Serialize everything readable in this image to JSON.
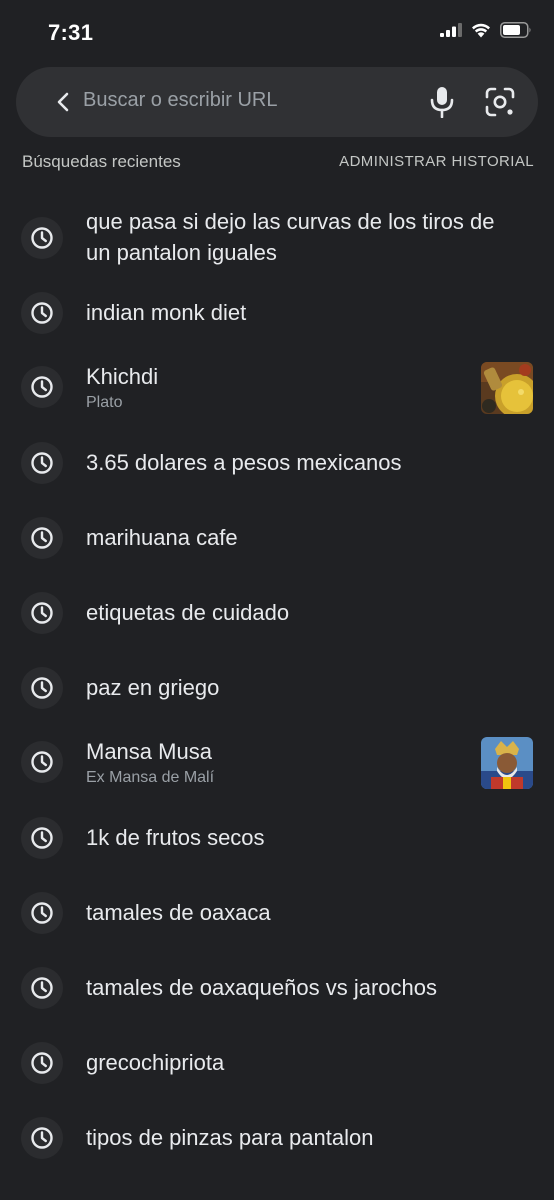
{
  "status_bar": {
    "time": "7:31"
  },
  "search": {
    "placeholder": "Buscar o escribir URL"
  },
  "recent": {
    "title": "Búsquedas recientes",
    "manage_label": "ADMINISTRAR HISTORIAL",
    "items": [
      {
        "line1": "que pasa si dejo las curvas de los tiros de",
        "line2": "un pantalon iguales"
      },
      {
        "title": "indian monk diet"
      },
      {
        "title": "Khichdi",
        "subtitle": "Plato"
      },
      {
        "title": "3.65 dolares a pesos mexicanos"
      },
      {
        "title": "marihuana cafe"
      },
      {
        "title": "etiquetas de cuidado"
      },
      {
        "title": "paz en griego"
      },
      {
        "title": "Mansa Musa",
        "subtitle": "Ex Mansa de Malí"
      },
      {
        "title": "1k de frutos secos"
      },
      {
        "title": "tamales de oaxaca"
      },
      {
        "title": "tamales de oaxaqueños vs jarochos"
      },
      {
        "title": "grecochipriota"
      },
      {
        "title": "tipos de pinzas para pantalon"
      }
    ]
  },
  "icons": {
    "back": "back-arrow-icon",
    "mic": "microphone-icon",
    "lens": "camera-search-icon",
    "history": "clock-icon"
  },
  "colors": {
    "background": "#202124",
    "search_bar": "#303134",
    "text_primary": "#e8eaed",
    "text_secondary": "#9aa0a6"
  }
}
